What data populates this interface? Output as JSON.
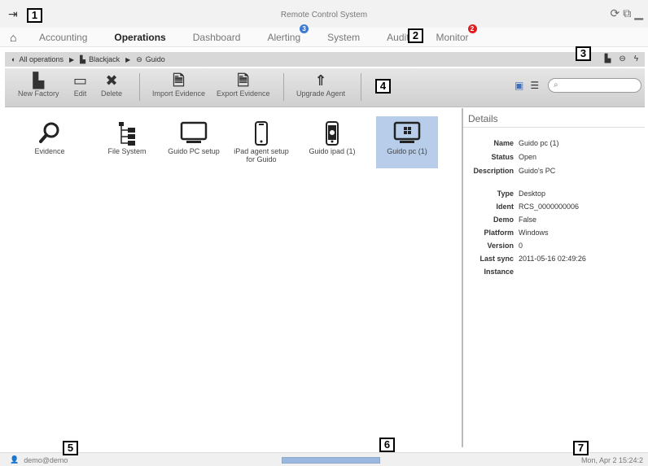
{
  "window": {
    "title": "Remote Control System"
  },
  "menu": {
    "items": [
      {
        "label": "Accounting"
      },
      {
        "label": "Operations",
        "active": true
      },
      {
        "label": "Dashboard"
      },
      {
        "label": "Alerting",
        "badge": "3",
        "badge_color": "#3a7bd5"
      },
      {
        "label": "System"
      },
      {
        "label": "Audit"
      },
      {
        "label": "Monitor",
        "badge": "2",
        "badge_color": "#e02020"
      }
    ]
  },
  "breadcrumb": {
    "items": [
      "All operations",
      "Blackjack",
      "Guido"
    ]
  },
  "toolbar": {
    "new_factory": "New Factory",
    "edit": "Edit",
    "delete": "Delete",
    "import_evidence": "Import Evidence",
    "export_evidence": "Export Evidence",
    "upgrade_agent": "Upgrade Agent",
    "search_value": ""
  },
  "items": [
    {
      "label": "Evidence",
      "icon": "magnifier-icon"
    },
    {
      "label": "File System",
      "icon": "tree-icon"
    },
    {
      "label": "Guido PC setup",
      "icon": "monitor-icon"
    },
    {
      "label": "iPad agent setup for Guido",
      "icon": "ipad-icon"
    },
    {
      "label": "Guido ipad (1)",
      "icon": "ipad-apple-icon"
    },
    {
      "label": "Guido pc (1)",
      "icon": "monitor-windows-icon",
      "selected": true
    }
  ],
  "details": {
    "title": "Details",
    "rows": [
      {
        "key": "Name",
        "value": "Guido pc (1)"
      },
      {
        "key": "Status",
        "value": "Open"
      },
      {
        "key": "Description",
        "value": "Guido's PC"
      },
      {
        "key": "Type",
        "value": "Desktop"
      },
      {
        "key": "Ident",
        "value": "RCS_0000000006"
      },
      {
        "key": "Demo",
        "value": "False"
      },
      {
        "key": "Platform",
        "value": "Windows"
      },
      {
        "key": "Version",
        "value": "0"
      },
      {
        "key": "Last sync",
        "value": "2011-05-16 02:49:26"
      },
      {
        "key": "Instance",
        "value": ""
      }
    ]
  },
  "status": {
    "user": "demo@demo",
    "clock": "Mon, Apr 2  15:24:2",
    "progress": 1.0
  },
  "callouts": [
    "1",
    "2",
    "3",
    "4",
    "5",
    "6",
    "7"
  ],
  "colors": {
    "selection": "#b7cde9",
    "progress": "#9ab8e0"
  }
}
